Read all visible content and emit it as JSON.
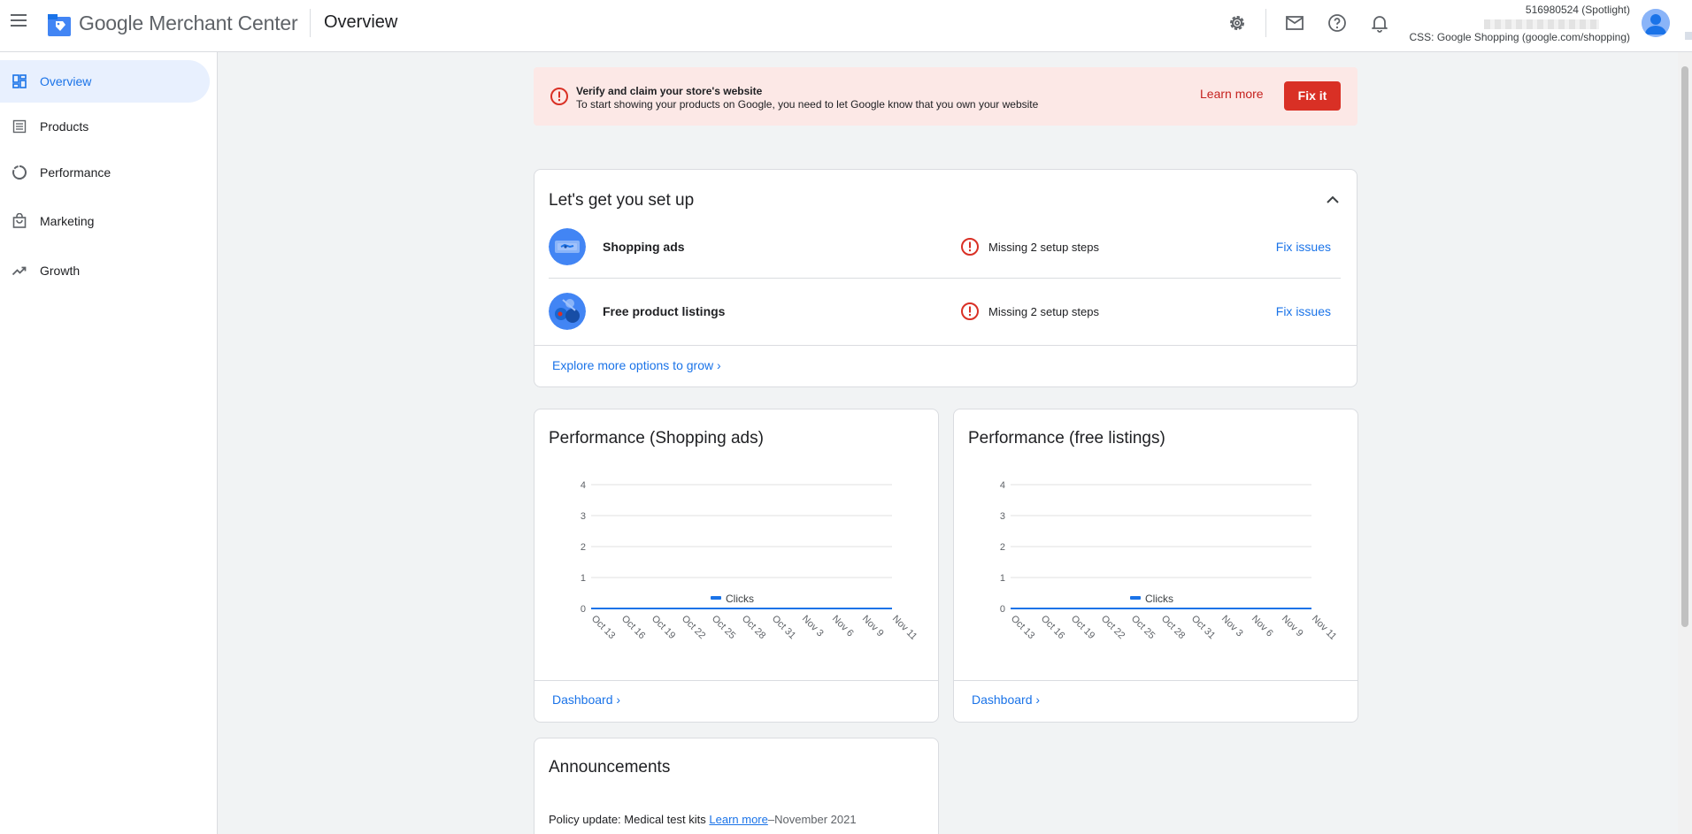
{
  "header": {
    "brand": "Google Merchant Center",
    "page_title": "Overview",
    "account_id": "516980524 (Spotlight)",
    "account_css": "CSS: Google Shopping (google.com/shopping)",
    "icons": [
      "settings-icon",
      "mail-icon",
      "help-icon",
      "notifications-icon"
    ]
  },
  "sidebar": {
    "items": [
      {
        "label": "Overview",
        "icon": "dashboard-icon",
        "active": true
      },
      {
        "label": "Products",
        "icon": "list-icon"
      },
      {
        "label": "Performance",
        "icon": "donut-icon"
      },
      {
        "label": "Marketing",
        "icon": "bag-icon"
      },
      {
        "label": "Growth",
        "icon": "trending-up-icon"
      }
    ]
  },
  "banner": {
    "title": "Verify and claim your store's website",
    "message": "To start showing your products on Google, you need to let Google know that you own your website",
    "learn_more": "Learn more",
    "fix_it": "Fix it"
  },
  "setup": {
    "title": "Let's get you set up",
    "rows": [
      {
        "name": "Shopping ads",
        "status": "Missing 2 setup steps",
        "action": "Fix issues"
      },
      {
        "name": "Free product listings",
        "status": "Missing 2 setup steps",
        "action": "Fix issues"
      }
    ],
    "explore": "Explore more options to grow"
  },
  "perf_cards": [
    {
      "title": "Performance (Shopping ads)",
      "link": "Dashboard"
    },
    {
      "title": "Performance (free listings)",
      "link": "Dashboard"
    }
  ],
  "chart_data": [
    {
      "type": "line",
      "title": "Performance (Shopping ads)",
      "x": [
        "Oct 13",
        "Oct 16",
        "Oct 19",
        "Oct 22",
        "Oct 25",
        "Oct 28",
        "Oct 31",
        "Nov 3",
        "Nov 6",
        "Nov 9",
        "Nov 11"
      ],
      "series": [
        {
          "name": "Clicks",
          "values": [
            0,
            0,
            0,
            0,
            0,
            0,
            0,
            0,
            0,
            0,
            0
          ],
          "color": "#1a73e8"
        }
      ],
      "yticks": [
        0,
        1,
        2,
        3,
        4
      ],
      "ylim": [
        0,
        4
      ],
      "legend": "bottom",
      "grid": true
    },
    {
      "type": "line",
      "title": "Performance (free listings)",
      "x": [
        "Oct 13",
        "Oct 16",
        "Oct 19",
        "Oct 22",
        "Oct 25",
        "Oct 28",
        "Oct 31",
        "Nov 3",
        "Nov 6",
        "Nov 9",
        "Nov 11"
      ],
      "series": [
        {
          "name": "Clicks",
          "values": [
            0,
            0,
            0,
            0,
            0,
            0,
            0,
            0,
            0,
            0,
            0
          ],
          "color": "#1a73e8"
        }
      ],
      "yticks": [
        0,
        1,
        2,
        3,
        4
      ],
      "ylim": [
        0,
        4
      ],
      "legend": "bottom",
      "grid": true
    }
  ],
  "announcements": {
    "title": "Announcements",
    "item_text": "Policy update: Medical test kits",
    "item_link": "Learn more",
    "item_sep": "–",
    "item_date": "November 2021"
  },
  "colors": {
    "accent": "#1a73e8",
    "error": "#d93025",
    "banner_bg": "#fce8e6",
    "active_nav_bg": "#e8f0fe"
  }
}
